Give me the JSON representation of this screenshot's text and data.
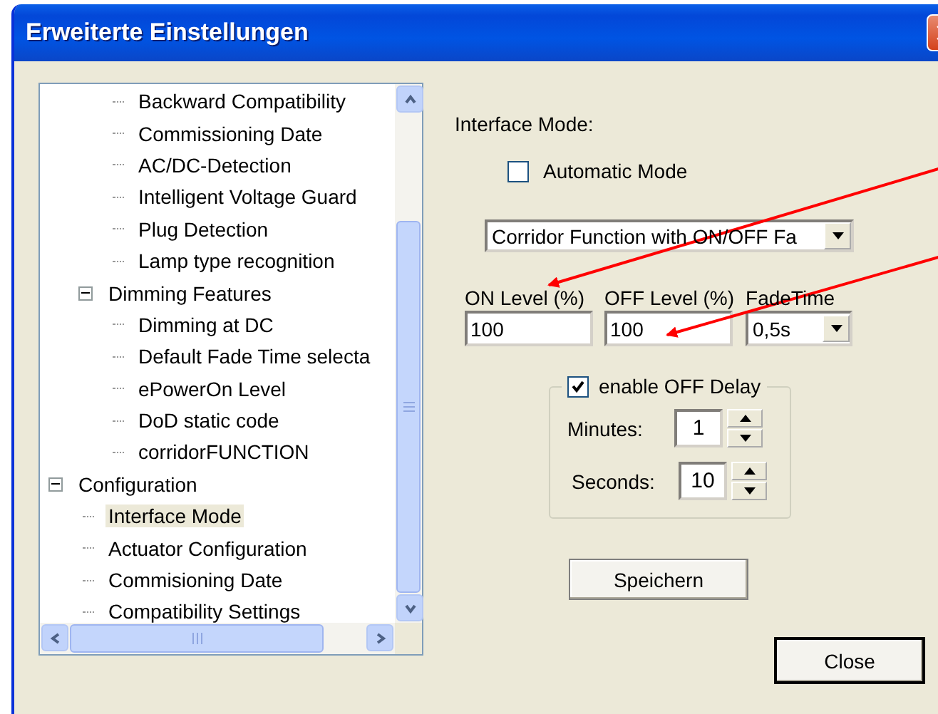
{
  "window": {
    "title": "Erweiterte Einstellungen"
  },
  "tree": [
    {
      "children": [
        {
          "children": [
            {
              "label": "Backward Compatibility",
              "selected": false
            },
            {
              "label": "Commissioning Date",
              "selected": false
            },
            {
              "label": "AC/DC-Detection",
              "selected": false
            },
            {
              "label": "Intelligent Voltage Guard",
              "selected": false
            },
            {
              "label": "Plug Detection",
              "selected": false
            },
            {
              "label": "Lamp type recognition",
              "selected": false
            }
          ]
        },
        {
          "label": "Dimming Features",
          "selected": false,
          "expanded": true,
          "children": [
            {
              "label": "Dimming at DC",
              "selected": false
            },
            {
              "label": "Default Fade Time selecta",
              "selected": false
            },
            {
              "label": "ePowerOn Level",
              "selected": false
            },
            {
              "label": "DoD static code",
              "selected": false
            },
            {
              "label": "corridorFUNCTION",
              "selected": false
            }
          ]
        }
      ]
    },
    {
      "label": "Configuration",
      "selected": false,
      "expanded": true,
      "children": [
        {
          "label": "Interface Mode",
          "selected": true
        },
        {
          "label": "Actuator Configuration",
          "selected": false
        },
        {
          "label": "Commisioning Date",
          "selected": false
        },
        {
          "label": "Compatibility Settings",
          "selected": false
        }
      ]
    }
  ],
  "settings": {
    "heading": "Interface Mode:",
    "automatic_mode": {
      "label": "Automatic Mode",
      "checked": false
    },
    "mode_select": {
      "value": "Corridor Function with ON/OFF Fa"
    },
    "fields": [
      {
        "label": "ON Level (%)",
        "value": "100",
        "kind": "text"
      },
      {
        "label": "OFF Level (%)",
        "value": "100",
        "kind": "text"
      },
      {
        "label": "FadeTime",
        "value": "0,5s",
        "kind": "select"
      }
    ],
    "off_delay": {
      "label": "enable OFF Delay",
      "checked": true,
      "spinners": [
        {
          "label": "Minutes:",
          "value": "1"
        },
        {
          "label": "Seconds:",
          "value": "10"
        }
      ]
    },
    "save_button": "Speichern"
  },
  "close_button": "Close"
}
